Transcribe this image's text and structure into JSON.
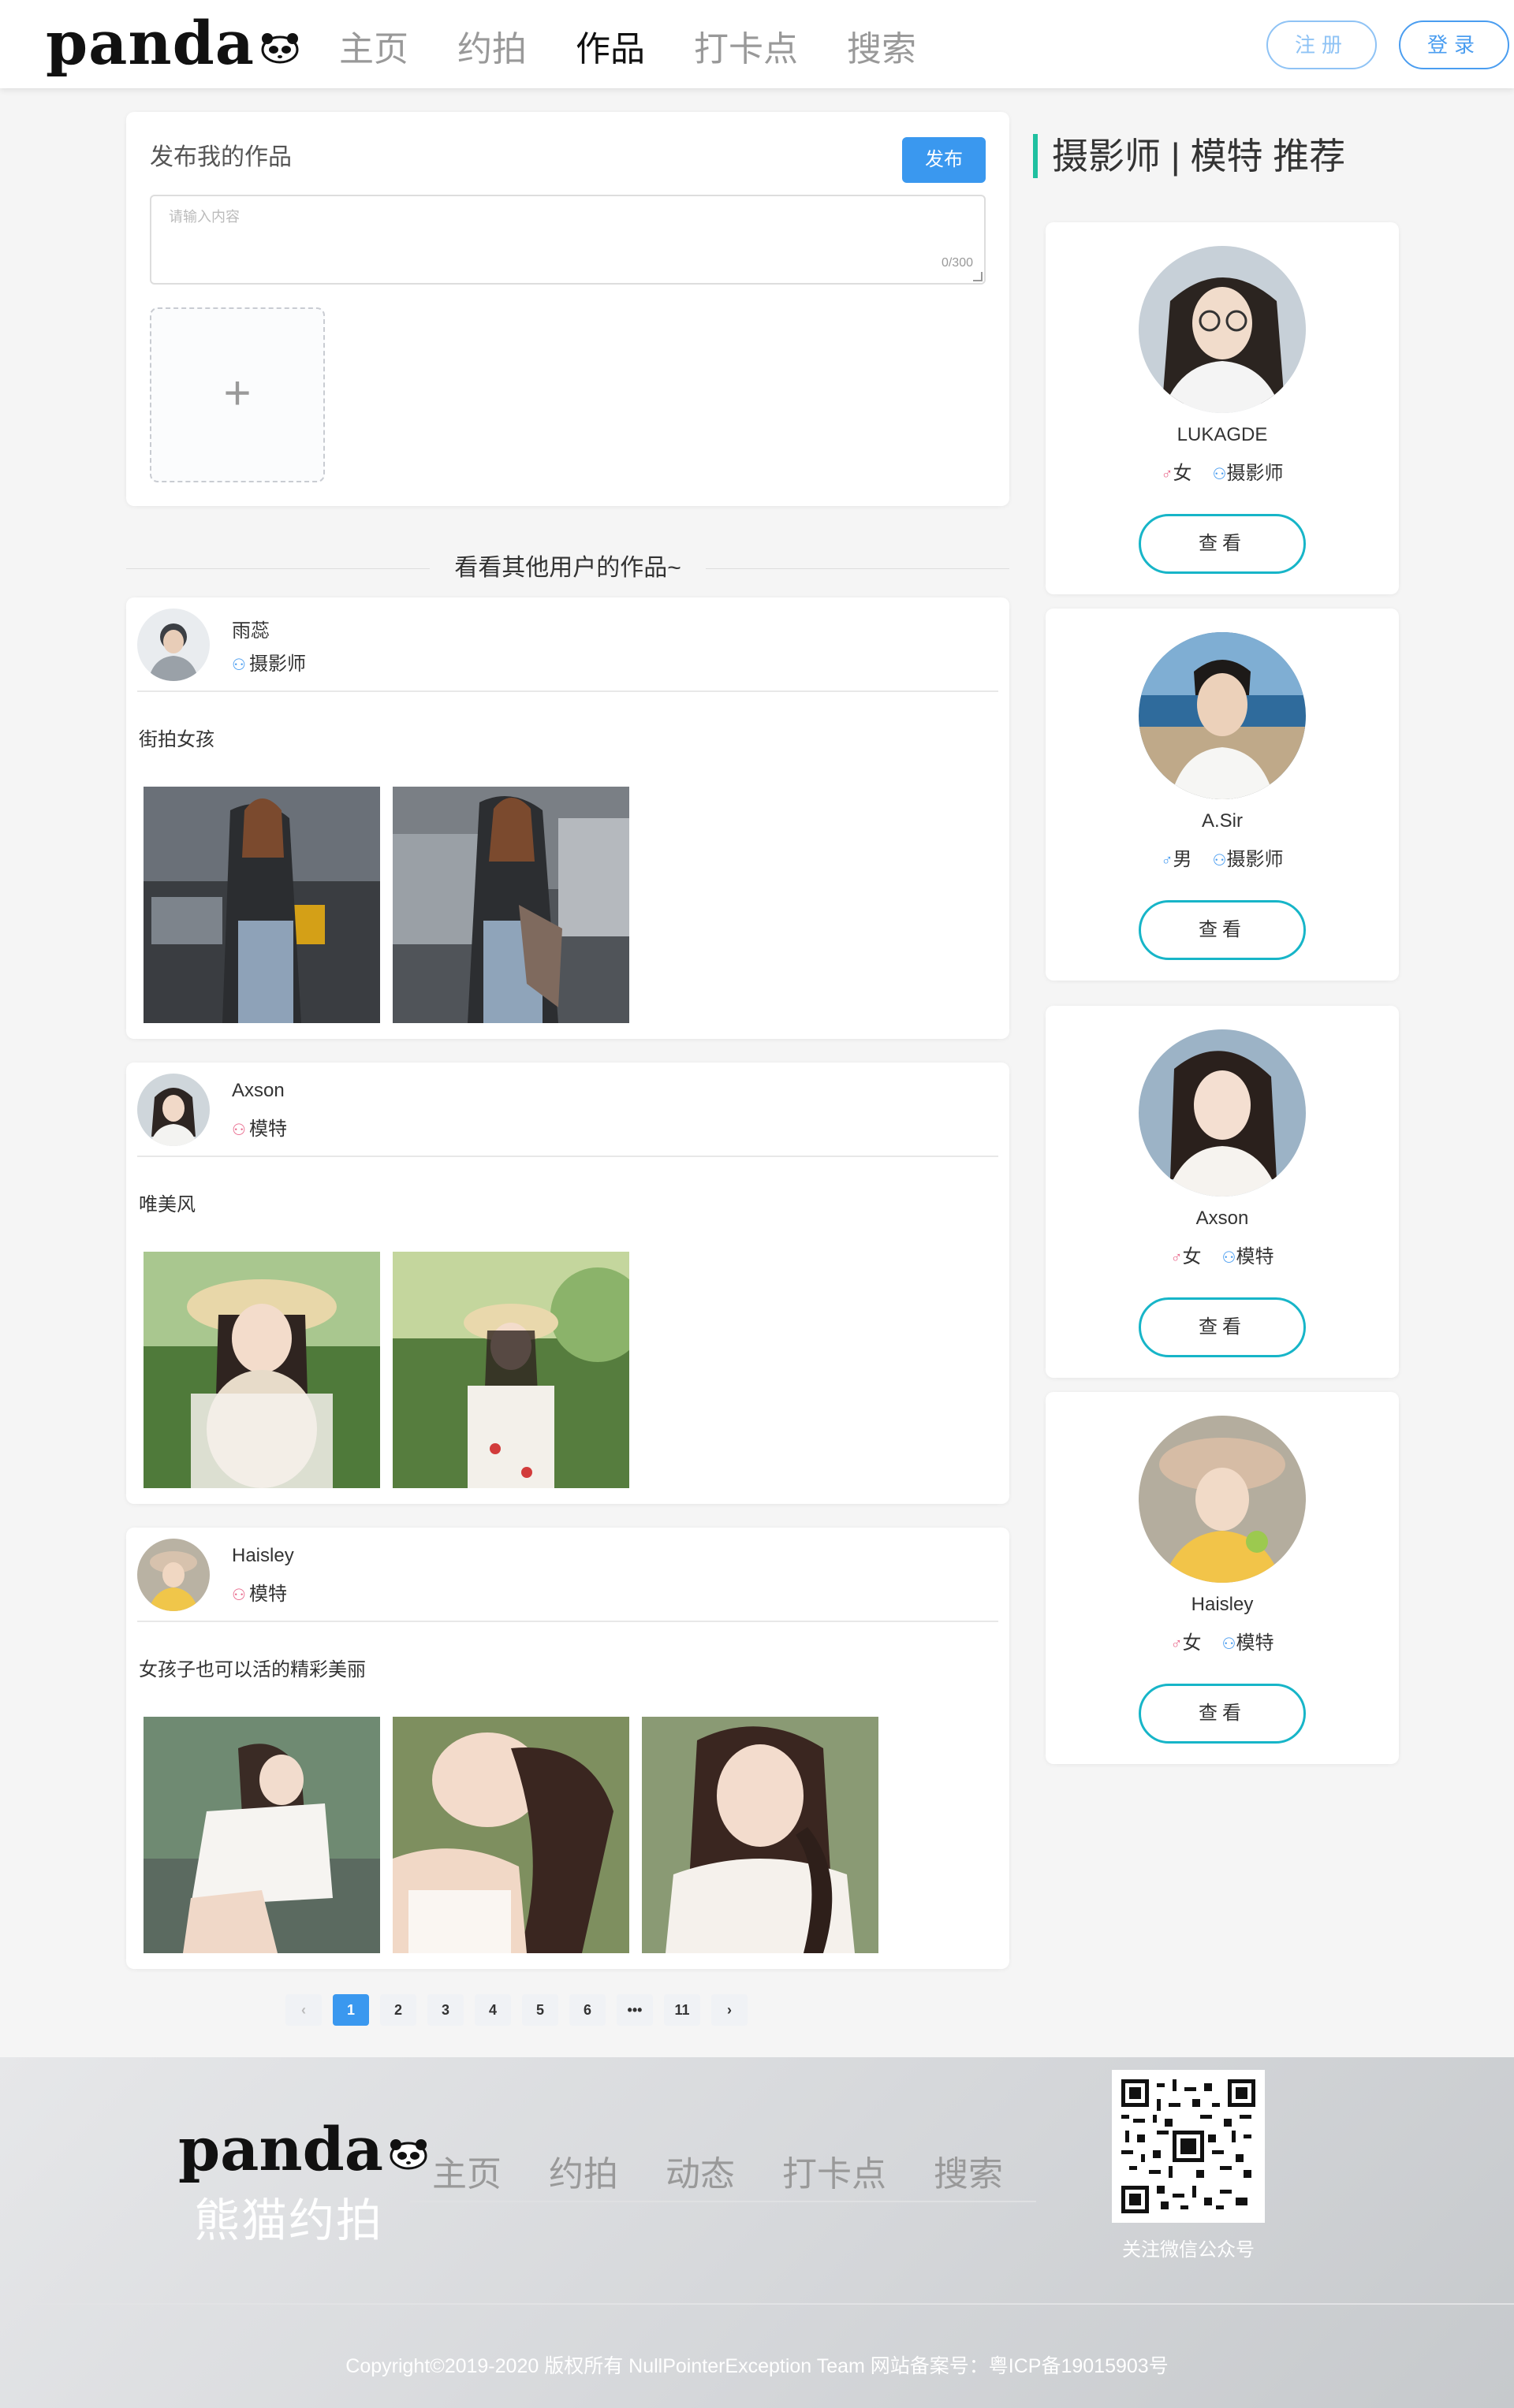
{
  "header": {
    "logo": "panda",
    "nav": [
      "主页",
      "约拍",
      "作品",
      "打卡点",
      "搜索"
    ],
    "active_nav": "作品",
    "register": "注册",
    "login": "登录"
  },
  "publish": {
    "title": "发布我的作品",
    "button": "发布",
    "placeholder": "请输入内容",
    "counter": "0/300",
    "upload_icon": "plus-icon"
  },
  "divider_text": "看看其他用户的作品~",
  "posts": [
    {
      "name": "雨蕊",
      "role": "摄影师",
      "role_icon": "user-icon",
      "text": "街拍女孩",
      "photo_count": 2
    },
    {
      "name": "Axson",
      "role": "模特",
      "role_icon": "user-icon",
      "text": "唯美风",
      "photo_count": 2
    },
    {
      "name": "Haisley",
      "role": "模特",
      "role_icon": "user-icon",
      "text": "女孩子也可以活的精彩美丽",
      "photo_count": 3
    }
  ],
  "recommend": {
    "title": "摄影师 | 模特 推荐",
    "items": [
      {
        "name": "LUKAGDE",
        "gender": "女",
        "gender_icon": "male-symbol-icon",
        "role": "摄影师",
        "button": "查看"
      },
      {
        "name": "A.Sir",
        "gender": "男",
        "gender_icon": "male-symbol-icon",
        "role": "摄影师",
        "button": "查看"
      },
      {
        "name": "Axson",
        "gender": "女",
        "gender_icon": "male-symbol-icon",
        "role": "模特",
        "button": "查看"
      },
      {
        "name": "Haisley",
        "gender": "女",
        "gender_icon": "male-symbol-icon",
        "role": "模特",
        "button": "查看"
      }
    ]
  },
  "pagination": {
    "prev": "‹",
    "pages": [
      "1",
      "2",
      "3",
      "4",
      "5",
      "6",
      "•••",
      "11"
    ],
    "current": "1",
    "next": "›"
  },
  "footer": {
    "logo": "panda",
    "brand": "熊猫约拍",
    "nav": [
      "主页",
      "约拍",
      "动态",
      "打卡点",
      "搜索"
    ],
    "qr_label": "关注微信公众号",
    "copyright": "Copyright©2019-2020 版权所有 NullPointerException Team 网站备案号：粤ICP备19015903号"
  },
  "colors": {
    "accent": "#3a98ef",
    "teal": "#20c0a0",
    "button_border": "#17b5c8"
  }
}
